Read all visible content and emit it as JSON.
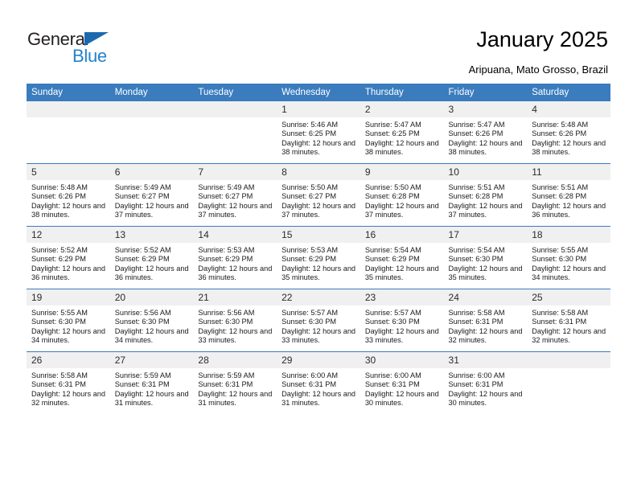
{
  "brand": {
    "name_dark": "General",
    "name_blue": "Blue",
    "accent_color": "#3a7cbe",
    "logo_blue": "#2283c8"
  },
  "header": {
    "title": "January 2025",
    "subtitle": "Aripuana, Mato Grosso, Brazil"
  },
  "calendar": {
    "weekday_headers": [
      "Sunday",
      "Monday",
      "Tuesday",
      "Wednesday",
      "Thursday",
      "Friday",
      "Saturday"
    ],
    "weeks": [
      [
        {
          "day": "",
          "empty": true
        },
        {
          "day": "",
          "empty": true
        },
        {
          "day": "",
          "empty": true
        },
        {
          "day": "1",
          "sunrise": "Sunrise: 5:46 AM",
          "sunset": "Sunset: 6:25 PM",
          "daylight": "Daylight: 12 hours and 38 minutes."
        },
        {
          "day": "2",
          "sunrise": "Sunrise: 5:47 AM",
          "sunset": "Sunset: 6:25 PM",
          "daylight": "Daylight: 12 hours and 38 minutes."
        },
        {
          "day": "3",
          "sunrise": "Sunrise: 5:47 AM",
          "sunset": "Sunset: 6:26 PM",
          "daylight": "Daylight: 12 hours and 38 minutes."
        },
        {
          "day": "4",
          "sunrise": "Sunrise: 5:48 AM",
          "sunset": "Sunset: 6:26 PM",
          "daylight": "Daylight: 12 hours and 38 minutes."
        }
      ],
      [
        {
          "day": "5",
          "sunrise": "Sunrise: 5:48 AM",
          "sunset": "Sunset: 6:26 PM",
          "daylight": "Daylight: 12 hours and 38 minutes."
        },
        {
          "day": "6",
          "sunrise": "Sunrise: 5:49 AM",
          "sunset": "Sunset: 6:27 PM",
          "daylight": "Daylight: 12 hours and 37 minutes."
        },
        {
          "day": "7",
          "sunrise": "Sunrise: 5:49 AM",
          "sunset": "Sunset: 6:27 PM",
          "daylight": "Daylight: 12 hours and 37 minutes."
        },
        {
          "day": "8",
          "sunrise": "Sunrise: 5:50 AM",
          "sunset": "Sunset: 6:27 PM",
          "daylight": "Daylight: 12 hours and 37 minutes."
        },
        {
          "day": "9",
          "sunrise": "Sunrise: 5:50 AM",
          "sunset": "Sunset: 6:28 PM",
          "daylight": "Daylight: 12 hours and 37 minutes."
        },
        {
          "day": "10",
          "sunrise": "Sunrise: 5:51 AM",
          "sunset": "Sunset: 6:28 PM",
          "daylight": "Daylight: 12 hours and 37 minutes."
        },
        {
          "day": "11",
          "sunrise": "Sunrise: 5:51 AM",
          "sunset": "Sunset: 6:28 PM",
          "daylight": "Daylight: 12 hours and 36 minutes."
        }
      ],
      [
        {
          "day": "12",
          "sunrise": "Sunrise: 5:52 AM",
          "sunset": "Sunset: 6:29 PM",
          "daylight": "Daylight: 12 hours and 36 minutes."
        },
        {
          "day": "13",
          "sunrise": "Sunrise: 5:52 AM",
          "sunset": "Sunset: 6:29 PM",
          "daylight": "Daylight: 12 hours and 36 minutes."
        },
        {
          "day": "14",
          "sunrise": "Sunrise: 5:53 AM",
          "sunset": "Sunset: 6:29 PM",
          "daylight": "Daylight: 12 hours and 36 minutes."
        },
        {
          "day": "15",
          "sunrise": "Sunrise: 5:53 AM",
          "sunset": "Sunset: 6:29 PM",
          "daylight": "Daylight: 12 hours and 35 minutes."
        },
        {
          "day": "16",
          "sunrise": "Sunrise: 5:54 AM",
          "sunset": "Sunset: 6:29 PM",
          "daylight": "Daylight: 12 hours and 35 minutes."
        },
        {
          "day": "17",
          "sunrise": "Sunrise: 5:54 AM",
          "sunset": "Sunset: 6:30 PM",
          "daylight": "Daylight: 12 hours and 35 minutes."
        },
        {
          "day": "18",
          "sunrise": "Sunrise: 5:55 AM",
          "sunset": "Sunset: 6:30 PM",
          "daylight": "Daylight: 12 hours and 34 minutes."
        }
      ],
      [
        {
          "day": "19",
          "sunrise": "Sunrise: 5:55 AM",
          "sunset": "Sunset: 6:30 PM",
          "daylight": "Daylight: 12 hours and 34 minutes."
        },
        {
          "day": "20",
          "sunrise": "Sunrise: 5:56 AM",
          "sunset": "Sunset: 6:30 PM",
          "daylight": "Daylight: 12 hours and 34 minutes."
        },
        {
          "day": "21",
          "sunrise": "Sunrise: 5:56 AM",
          "sunset": "Sunset: 6:30 PM",
          "daylight": "Daylight: 12 hours and 33 minutes."
        },
        {
          "day": "22",
          "sunrise": "Sunrise: 5:57 AM",
          "sunset": "Sunset: 6:30 PM",
          "daylight": "Daylight: 12 hours and 33 minutes."
        },
        {
          "day": "23",
          "sunrise": "Sunrise: 5:57 AM",
          "sunset": "Sunset: 6:30 PM",
          "daylight": "Daylight: 12 hours and 33 minutes."
        },
        {
          "day": "24",
          "sunrise": "Sunrise: 5:58 AM",
          "sunset": "Sunset: 6:31 PM",
          "daylight": "Daylight: 12 hours and 32 minutes."
        },
        {
          "day": "25",
          "sunrise": "Sunrise: 5:58 AM",
          "sunset": "Sunset: 6:31 PM",
          "daylight": "Daylight: 12 hours and 32 minutes."
        }
      ],
      [
        {
          "day": "26",
          "sunrise": "Sunrise: 5:58 AM",
          "sunset": "Sunset: 6:31 PM",
          "daylight": "Daylight: 12 hours and 32 minutes."
        },
        {
          "day": "27",
          "sunrise": "Sunrise: 5:59 AM",
          "sunset": "Sunset: 6:31 PM",
          "daylight": "Daylight: 12 hours and 31 minutes."
        },
        {
          "day": "28",
          "sunrise": "Sunrise: 5:59 AM",
          "sunset": "Sunset: 6:31 PM",
          "daylight": "Daylight: 12 hours and 31 minutes."
        },
        {
          "day": "29",
          "sunrise": "Sunrise: 6:00 AM",
          "sunset": "Sunset: 6:31 PM",
          "daylight": "Daylight: 12 hours and 31 minutes."
        },
        {
          "day": "30",
          "sunrise": "Sunrise: 6:00 AM",
          "sunset": "Sunset: 6:31 PM",
          "daylight": "Daylight: 12 hours and 30 minutes."
        },
        {
          "day": "31",
          "sunrise": "Sunrise: 6:00 AM",
          "sunset": "Sunset: 6:31 PM",
          "daylight": "Daylight: 12 hours and 30 minutes."
        },
        {
          "day": "",
          "empty": true
        }
      ]
    ]
  }
}
